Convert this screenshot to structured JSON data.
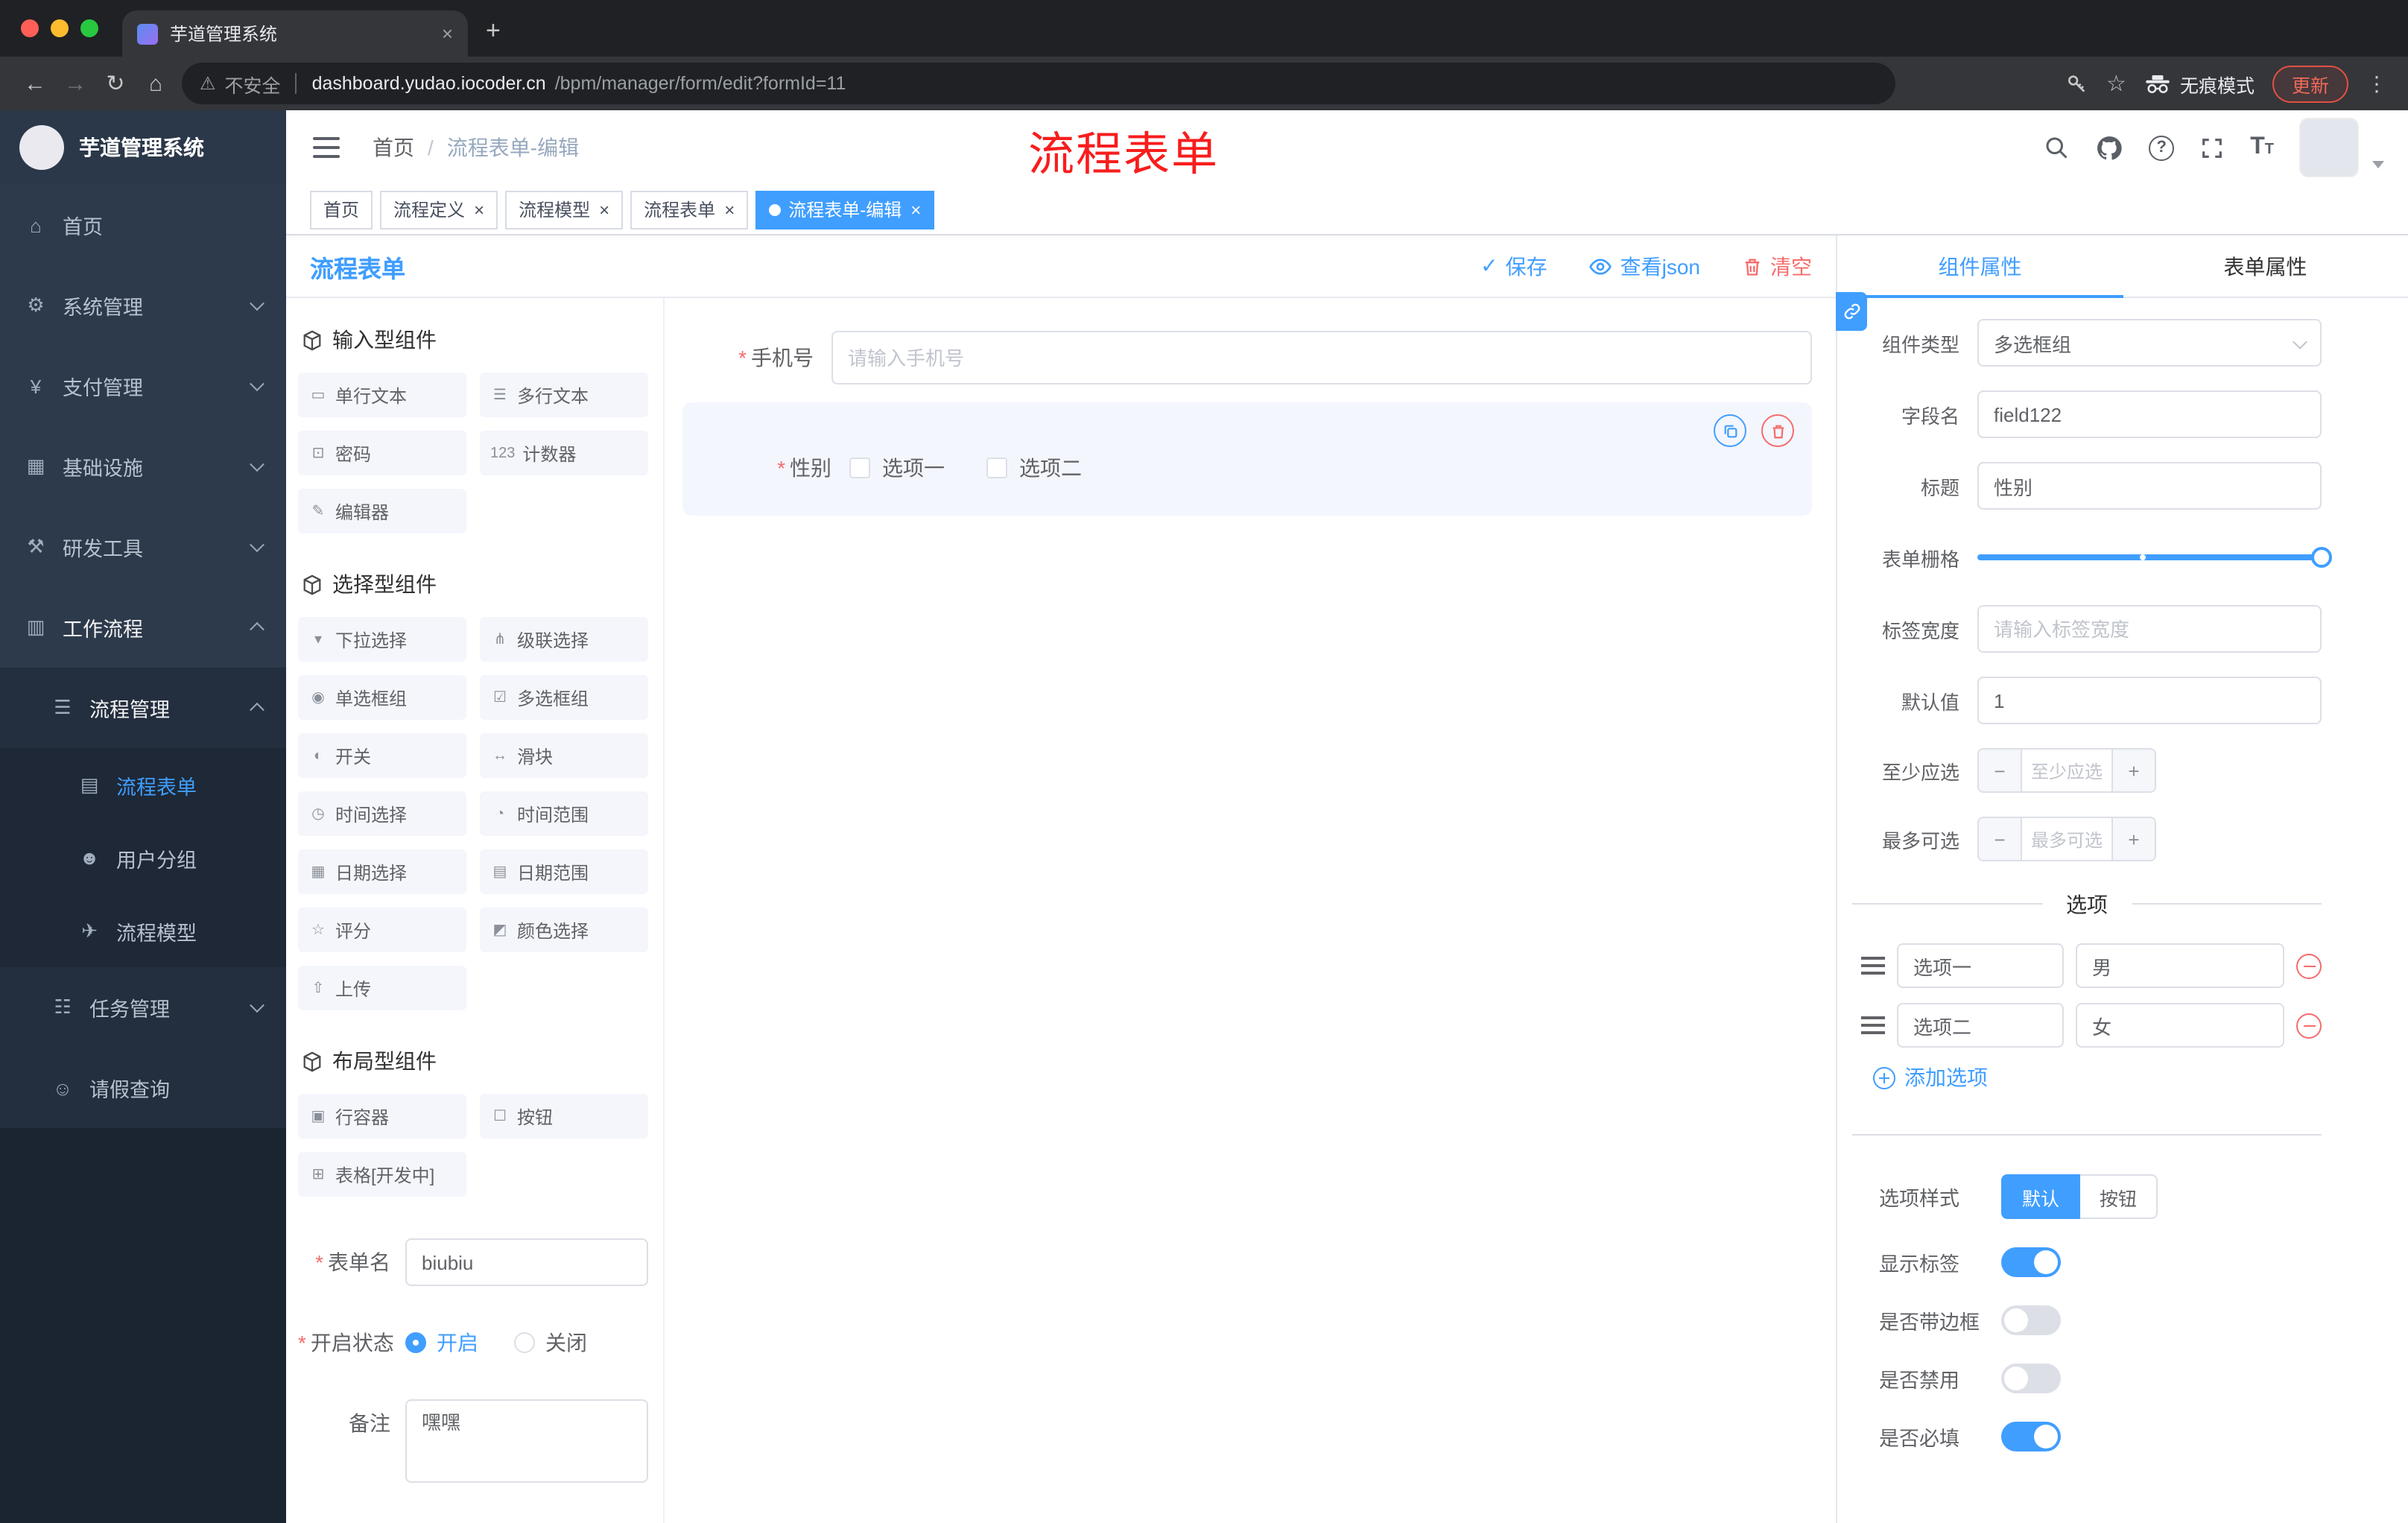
{
  "browser": {
    "tab_title": "芋道管理系统",
    "security_label": "不安全",
    "url_domain": "dashboard.yudao.iocoder.cn",
    "url_path": "/bpm/manager/form/edit?formId=11",
    "incognito_label": "无痕模式",
    "update_label": "更新"
  },
  "icons": {
    "back": "←",
    "forward": "→",
    "reload": "↻",
    "home": "⌂",
    "warning": "⚠",
    "star": "☆",
    "kebab": "⋮",
    "new_tab": "+",
    "close": "×",
    "check": "✓"
  },
  "overlay": {
    "annotation": "流程表单",
    "color": "#f81d1d"
  },
  "sidebar": {
    "logo_title": "芋道管理系统",
    "items": [
      {
        "label": "首页",
        "icon": "⌂"
      },
      {
        "label": "系统管理",
        "icon": "⚙"
      },
      {
        "label": "支付管理",
        "icon": "¥"
      },
      {
        "label": "基础设施",
        "icon": "▦"
      },
      {
        "label": "研发工具",
        "icon": "⚒"
      },
      {
        "label": "工作流程",
        "icon": "▥"
      },
      {
        "label": "流程管理",
        "icon": "☰"
      },
      {
        "label": "流程表单",
        "icon": "▤"
      },
      {
        "label": "用户分组",
        "icon": "☻"
      },
      {
        "label": "流程模型",
        "icon": "✈"
      },
      {
        "label": "任务管理",
        "icon": "☷"
      },
      {
        "label": "请假查询",
        "icon": "☺"
      }
    ]
  },
  "header": {
    "breadcrumb_home": "首页",
    "breadcrumb_sep": "/",
    "breadcrumb_current": "流程表单-编辑"
  },
  "tags": [
    {
      "label": "首页"
    },
    {
      "label": "流程定义"
    },
    {
      "label": "流程模型"
    },
    {
      "label": "流程表单"
    },
    {
      "label": "流程表单-编辑"
    }
  ],
  "designer": {
    "title": "流程表单",
    "save_label": "保存",
    "view_json_label": "查看json",
    "clear_label": "清空",
    "groups": [
      {
        "title": "输入型组件",
        "items": [
          {
            "label": "单行文本",
            "icon": "▭"
          },
          {
            "label": "多行文本",
            "icon": "☰"
          },
          {
            "label": "密码",
            "icon": "⊡"
          },
          {
            "label": "计数器",
            "icon": "123"
          },
          {
            "label": "编辑器",
            "icon": "✎"
          }
        ]
      },
      {
        "title": "选择型组件",
        "items": [
          {
            "label": "下拉选择",
            "icon": "▾"
          },
          {
            "label": "级联选择",
            "icon": "⋔"
          },
          {
            "label": "单选框组",
            "icon": "◉"
          },
          {
            "label": "多选框组",
            "icon": "☑"
          },
          {
            "label": "开关",
            "icon": "◐"
          },
          {
            "label": "滑块",
            "icon": "↔"
          },
          {
            "label": "时间选择",
            "icon": "◷"
          },
          {
            "label": "时间范围",
            "icon": "◔"
          },
          {
            "label": "日期选择",
            "icon": "▦"
          },
          {
            "label": "日期范围",
            "icon": "▤"
          },
          {
            "label": "评分",
            "icon": "☆"
          },
          {
            "label": "颜色选择",
            "icon": "◩"
          },
          {
            "label": "上传",
            "icon": "⇧"
          }
        ]
      },
      {
        "title": "布局型组件",
        "items": [
          {
            "label": "行容器",
            "icon": "▣"
          },
          {
            "label": "按钮",
            "icon": "☐"
          },
          {
            "label": "表格[开发中]",
            "icon": "⊞"
          }
        ]
      }
    ],
    "meta": {
      "name_label": "表单名",
      "name_value": "biubiu",
      "status_label": "开启状态",
      "status_on": "开启",
      "status_off": "关闭",
      "status_value": "开启",
      "remark_label": "备注",
      "remark_value": "嘿嘿"
    },
    "canvas": {
      "phone": {
        "label": "手机号",
        "placeholder": "请输入手机号",
        "required": true
      },
      "gender": {
        "label": "性别",
        "option1": "选项一",
        "option2": "选项二",
        "required": true,
        "selected": true
      }
    }
  },
  "props": {
    "tab_component": "组件属性",
    "tab_form": "表单属性",
    "active_tab": "组件属性",
    "component_type_label": "组件类型",
    "component_type_value": "多选框组",
    "field_name_label": "字段名",
    "field_name_value": "field122",
    "title_label": "标题",
    "title_value": "性别",
    "grid_label": "表单栅格",
    "label_width_label": "标签宽度",
    "label_width_placeholder": "请输入标签宽度",
    "default_label": "默认值",
    "default_value": "1",
    "min_label": "至少应选",
    "min_placeholder": "至少应选",
    "max_label": "最多可选",
    "max_placeholder": "最多可选",
    "options_title": "选项",
    "options": [
      {
        "label": "选项一",
        "value": "男"
      },
      {
        "label": "选项二",
        "value": "女"
      }
    ],
    "add_option_label": "添加选项",
    "style_label": "选项样式",
    "style_default": "默认",
    "style_button": "按钮",
    "style_value": "默认",
    "switch_show_label": "显示标签",
    "switch_border_label": "是否带边框",
    "switch_disabled_label": "是否禁用",
    "switch_required_label": "是否必填",
    "switch_states": {
      "show_label": true,
      "border": false,
      "disabled": false,
      "required": true
    },
    "accent_color": "#409eff",
    "danger_color": "#f56c6c"
  }
}
